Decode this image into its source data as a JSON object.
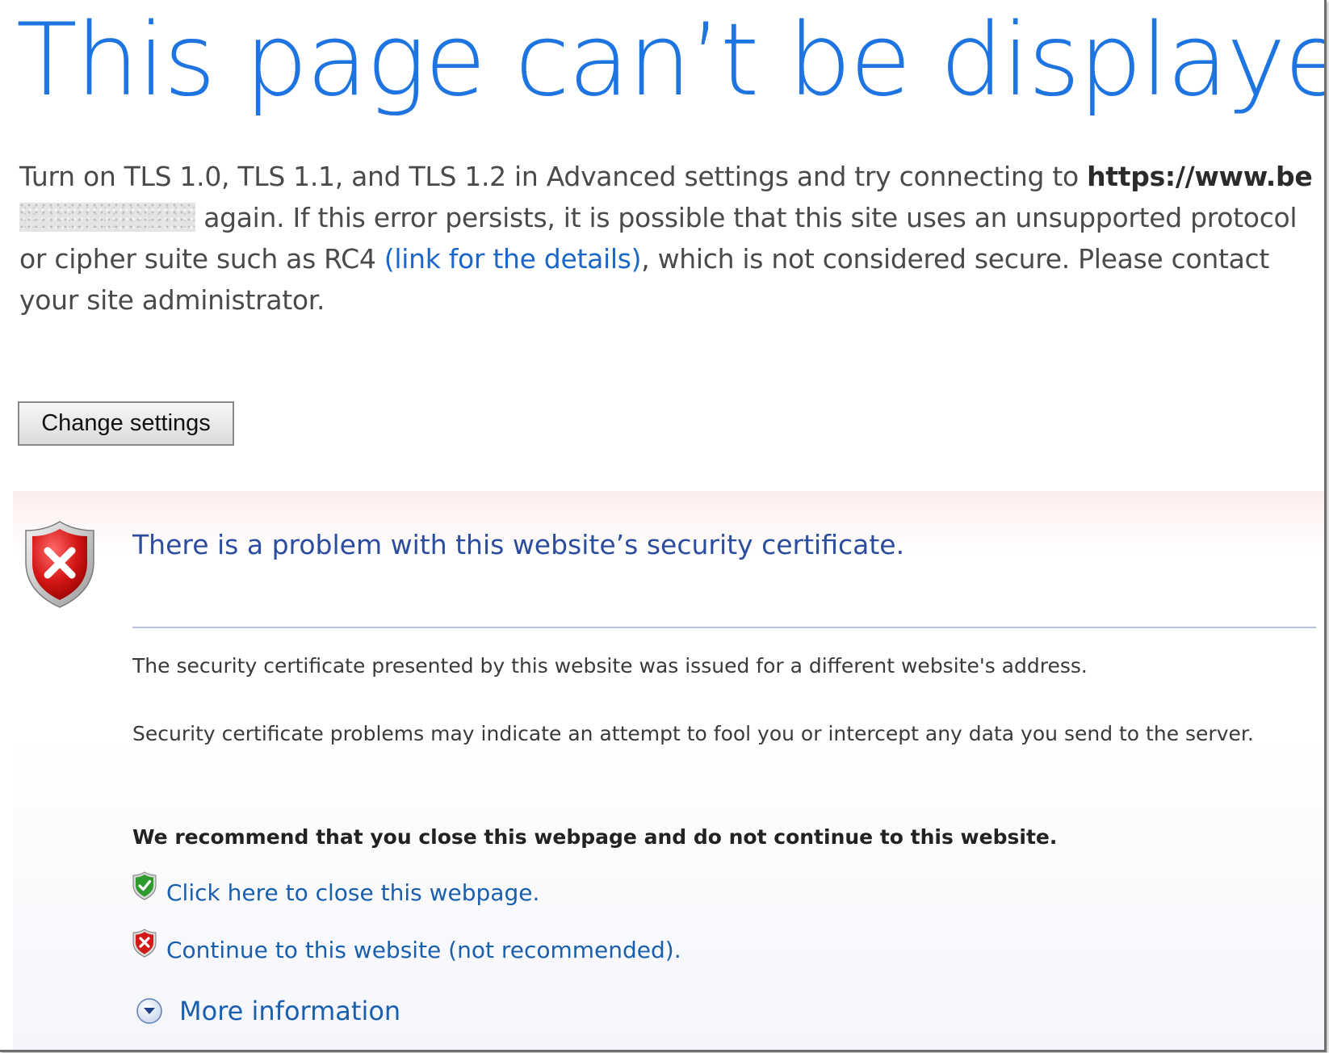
{
  "error_page": {
    "title": "This page can’t be displayed",
    "description": {
      "part1": "Turn on TLS 1.0, TLS 1.1, and TLS 1.2 in Advanced settings and try connecting to ",
      "url_visible": "https://www.be",
      "part2": " again. If this error persists, it is possible that this site uses an unsupported protocol or cipher suite such as RC4 ",
      "details_link": "(link for the details)",
      "part3": ", which is not considered secure. Please contact your site administrator."
    },
    "change_settings_button": "Change settings"
  },
  "certificate_warning": {
    "title": "There is a problem with this website’s security certificate.",
    "paragraph1": "The security certificate presented by this website was issued for a different website's address.",
    "paragraph2": "Security certificate problems may indicate an attempt to fool you or intercept any data you send to the server.",
    "recommendation": "We recommend that you close this webpage and do not continue to this website.",
    "close_link": "Click here to close this webpage.",
    "continue_link": "Continue to this website (not recommended).",
    "more_info_link": "More information"
  },
  "icons": {
    "warning_shield": "shield-error-icon",
    "close_shield": "shield-check-icon",
    "continue_shield": "shield-x-icon",
    "more_info": "chevron-down-circle-icon"
  },
  "colors": {
    "title_blue": "#1e74e0",
    "link_blue": "#1a5fae",
    "cert_title_blue": "#2c4c9e",
    "error_red": "#c8101a",
    "ok_green": "#2e8b2e"
  }
}
